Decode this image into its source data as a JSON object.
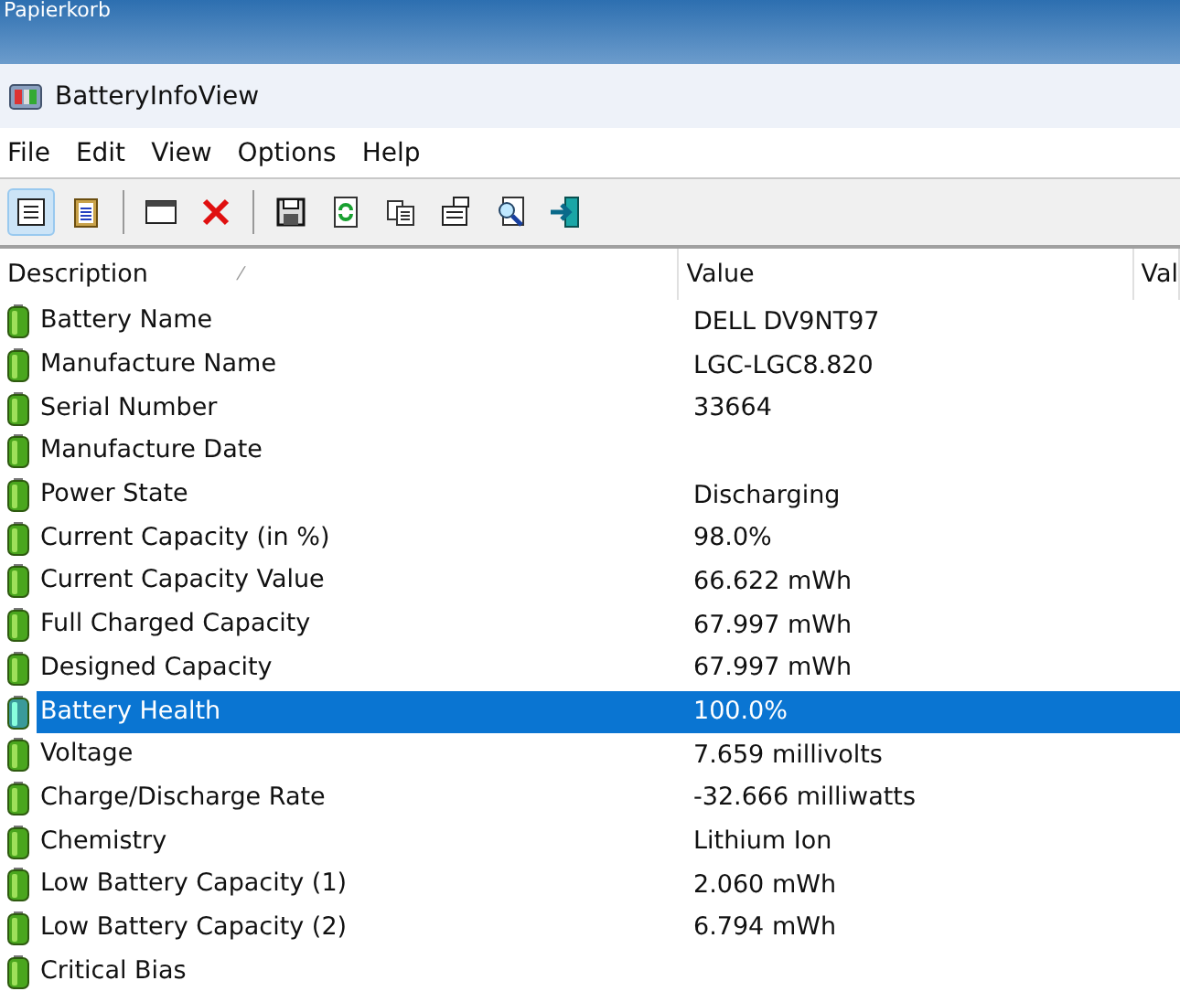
{
  "desktop": {
    "icon_label": "Papierkorb"
  },
  "window": {
    "title": "BatteryInfoView"
  },
  "menu": [
    "File",
    "Edit",
    "View",
    "Options",
    "Help"
  ],
  "toolbar": [
    {
      "kind": "properties",
      "selected": true
    },
    {
      "kind": "clipboard",
      "selected": false
    },
    {
      "kind": "sep"
    },
    {
      "kind": "window",
      "selected": false
    },
    {
      "kind": "delete",
      "selected": false
    },
    {
      "kind": "sep"
    },
    {
      "kind": "save",
      "selected": false
    },
    {
      "kind": "refresh",
      "selected": false
    },
    {
      "kind": "copy",
      "selected": false
    },
    {
      "kind": "options",
      "selected": false
    },
    {
      "kind": "find",
      "selected": false
    },
    {
      "kind": "exit",
      "selected": false
    }
  ],
  "table": {
    "columns": [
      "Description",
      "Value",
      "Val"
    ],
    "sort_mark": "⁄",
    "rows": [
      {
        "description": "Battery Name",
        "value": "DELL DV9NT97",
        "selected": false
      },
      {
        "description": "Manufacture Name",
        "value": "LGC-LGC8.820",
        "selected": false
      },
      {
        "description": "Serial Number",
        "value": "33664",
        "selected": false
      },
      {
        "description": "Manufacture Date",
        "value": "",
        "selected": false
      },
      {
        "description": "Power State",
        "value": "Discharging",
        "selected": false
      },
      {
        "description": "Current Capacity (in %)",
        "value": "98.0%",
        "selected": false
      },
      {
        "description": "Current Capacity Value",
        "value": "66.622 mWh",
        "selected": false
      },
      {
        "description": "Full Charged Capacity",
        "value": "67.997 mWh",
        "selected": false
      },
      {
        "description": "Designed Capacity",
        "value": "67.997 mWh",
        "selected": false
      },
      {
        "description": "Battery Health",
        "value": "100.0%",
        "selected": true
      },
      {
        "description": "Voltage",
        "value": "7.659 millivolts",
        "selected": false
      },
      {
        "description": "Charge/Discharge Rate",
        "value": "-32.666 milliwatts",
        "selected": false
      },
      {
        "description": "Chemistry",
        "value": "Lithium Ion",
        "selected": false
      },
      {
        "description": "Low Battery Capacity (1)",
        "value": "2.060 mWh",
        "selected": false
      },
      {
        "description": "Low Battery Capacity (2)",
        "value": "6.794 mWh",
        "selected": false
      },
      {
        "description": "Critical Bias",
        "value": "",
        "selected": false
      }
    ]
  }
}
